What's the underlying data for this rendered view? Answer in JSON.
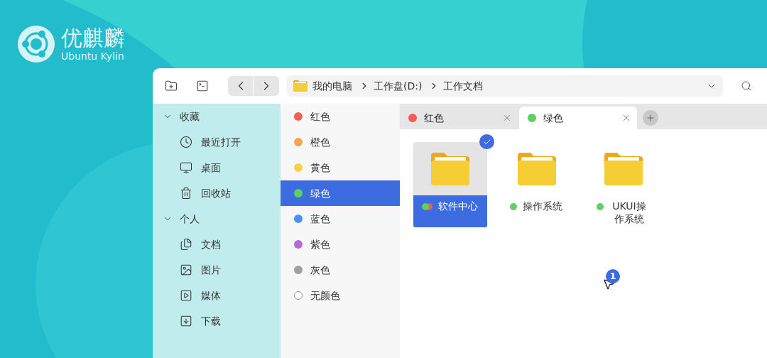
{
  "brand": {
    "name": "优麒麟",
    "subtitle": "Ubuntu Kylin"
  },
  "path": [
    "我的电脑",
    "工作盘(D:)",
    "工作文档"
  ],
  "sidebar": [
    {
      "label": "收藏",
      "expanded": true,
      "items": [
        {
          "label": "最近打开",
          "kind": "clock"
        },
        {
          "label": "桌面",
          "kind": "desktop"
        },
        {
          "label": "回收站",
          "kind": "trash"
        }
      ]
    },
    {
      "label": "个人",
      "expanded": true,
      "items": [
        {
          "label": "文档",
          "kind": "documents"
        },
        {
          "label": "图片",
          "kind": "pictures"
        },
        {
          "label": "媒体",
          "kind": "media"
        },
        {
          "label": "下载",
          "kind": "downloads"
        }
      ]
    }
  ],
  "color_labels": [
    {
      "label": "红色",
      "color": "#f65b55",
      "selected": false
    },
    {
      "label": "橙色",
      "color": "#fca24a",
      "selected": false
    },
    {
      "label": "黄色",
      "color": "#f8d04c",
      "selected": false
    },
    {
      "label": "绿色",
      "color": "#5dcf63",
      "selected": true
    },
    {
      "label": "蓝色",
      "color": "#4a8ff7",
      "selected": false
    },
    {
      "label": "紫色",
      "color": "#b36bd8",
      "selected": false
    },
    {
      "label": "灰色",
      "color": "#a0a0a4",
      "selected": false
    },
    {
      "label": "无颜色",
      "selected": false
    }
  ],
  "tabs": [
    {
      "label": "红色",
      "color": "#f65b55",
      "selected": false
    },
    {
      "label": "绿色",
      "color": "#5dcf63",
      "selected": true
    }
  ],
  "files": [
    {
      "name": "软件中心",
      "tags": [
        {
          "color": "#5dcf63"
        },
        {
          "color": "#f65b55"
        }
      ],
      "selected": true
    },
    {
      "name": "操作系统",
      "tags": [
        {
          "color": "#5dcf63"
        }
      ],
      "selected": false
    },
    {
      "name": "UKUI操作系统",
      "tags": [
        {
          "color": "#5dcf63"
        }
      ],
      "selected": false
    }
  ],
  "drag_count": "1"
}
